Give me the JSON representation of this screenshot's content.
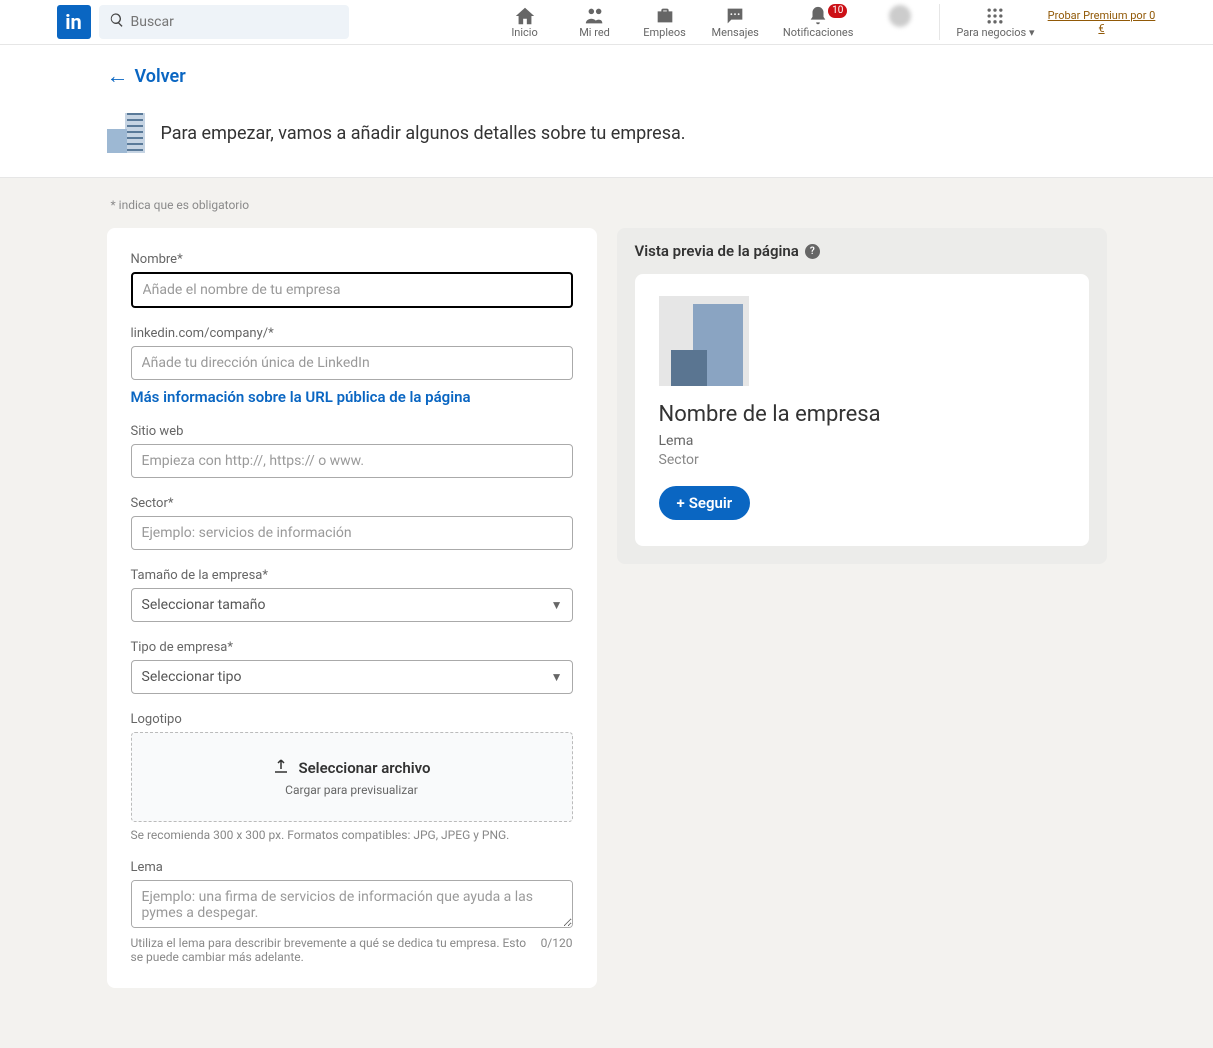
{
  "nav": {
    "search_placeholder": "Buscar",
    "items": [
      {
        "label": "Inicio"
      },
      {
        "label": "Mi red"
      },
      {
        "label": "Empleos"
      },
      {
        "label": "Mensajes"
      },
      {
        "label": "Notificaciones",
        "badge": "10"
      }
    ],
    "business": "Para negocios",
    "premium": "Probar Premium por 0 €"
  },
  "back": "Volver",
  "intro": "Para empezar, vamos a añadir algunos detalles sobre tu empresa.",
  "required": "*   indica que es obligatorio",
  "form": {
    "name_label": "Nombre*",
    "name_placeholder": "Añade el nombre de tu empresa",
    "url_label": "linkedin.com/company/*",
    "url_placeholder": "Añade tu dirección única de LinkedIn",
    "url_info": "Más información sobre la URL pública de la página",
    "website_label": "Sitio web",
    "website_placeholder": "Empieza con http://, https:// o www.",
    "sector_label": "Sector*",
    "sector_placeholder": "Ejemplo: servicios de información",
    "size_label": "Tamaño de la empresa*",
    "size_placeholder": "Seleccionar tamaño",
    "type_label": "Tipo de empresa*",
    "type_placeholder": "Seleccionar tipo",
    "logo_label": "Logotipo",
    "logo_select": "Seleccionar archivo",
    "logo_sub": "Cargar para previsualizar",
    "logo_hint": "Se recomienda 300 x 300 px. Formatos compatibles: JPG, JPEG y PNG.",
    "tagline_label": "Lema",
    "tagline_placeholder": "Ejemplo: una firma de servicios de información que ayuda a las pymes a despegar.",
    "tagline_hint": "Utiliza el lema para describir brevemente a qué se dedica tu empresa. Esto se puede cambiar más adelante.",
    "tagline_count": "0/120"
  },
  "preview": {
    "header": "Vista previa de la página",
    "name": "Nombre de la empresa",
    "tagline": "Lema",
    "sector": "Sector",
    "follow": "Seguir"
  }
}
